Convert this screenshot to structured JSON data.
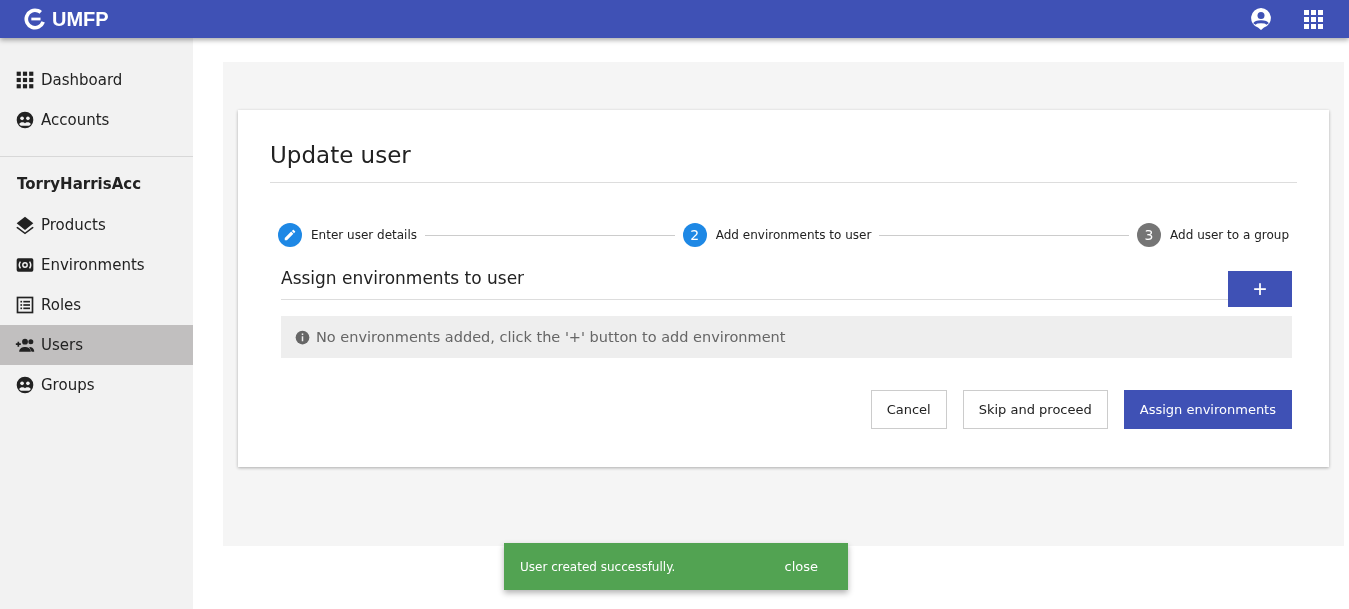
{
  "header": {
    "title": "UMFP"
  },
  "sidebar": {
    "top_items": [
      {
        "label": "Dashboard",
        "kind": "grid",
        "selected": false
      },
      {
        "label": "Accounts",
        "kind": "group",
        "selected": false
      }
    ],
    "account": "TorryHarrisAcc",
    "items": [
      {
        "label": "Products",
        "kind": "layers",
        "selected": false
      },
      {
        "label": "Environments",
        "kind": "env",
        "selected": false
      },
      {
        "label": "Roles",
        "kind": "list",
        "selected": false
      },
      {
        "label": "Users",
        "kind": "adduser",
        "selected": true
      },
      {
        "label": "Groups",
        "kind": "group",
        "selected": false
      }
    ]
  },
  "card": {
    "title": "Update user",
    "steps": [
      {
        "label": "Enter user details",
        "kind": "done"
      },
      {
        "label": "Add environments to user",
        "number": "2",
        "kind": "active"
      },
      {
        "label": "Add user to a group",
        "number": "3",
        "kind": "pending"
      }
    ],
    "section_title": "Assign environments to user",
    "add_button": "+",
    "info": "No environments added, click the '+' button to add environment",
    "buttons": [
      {
        "label": "Cancel",
        "kind": "outline"
      },
      {
        "label": "Skip and proceed",
        "kind": "outline"
      },
      {
        "label": "Assign environments",
        "kind": "primary"
      }
    ]
  },
  "snackbar": {
    "message": "User created successfully.",
    "action": "close"
  }
}
